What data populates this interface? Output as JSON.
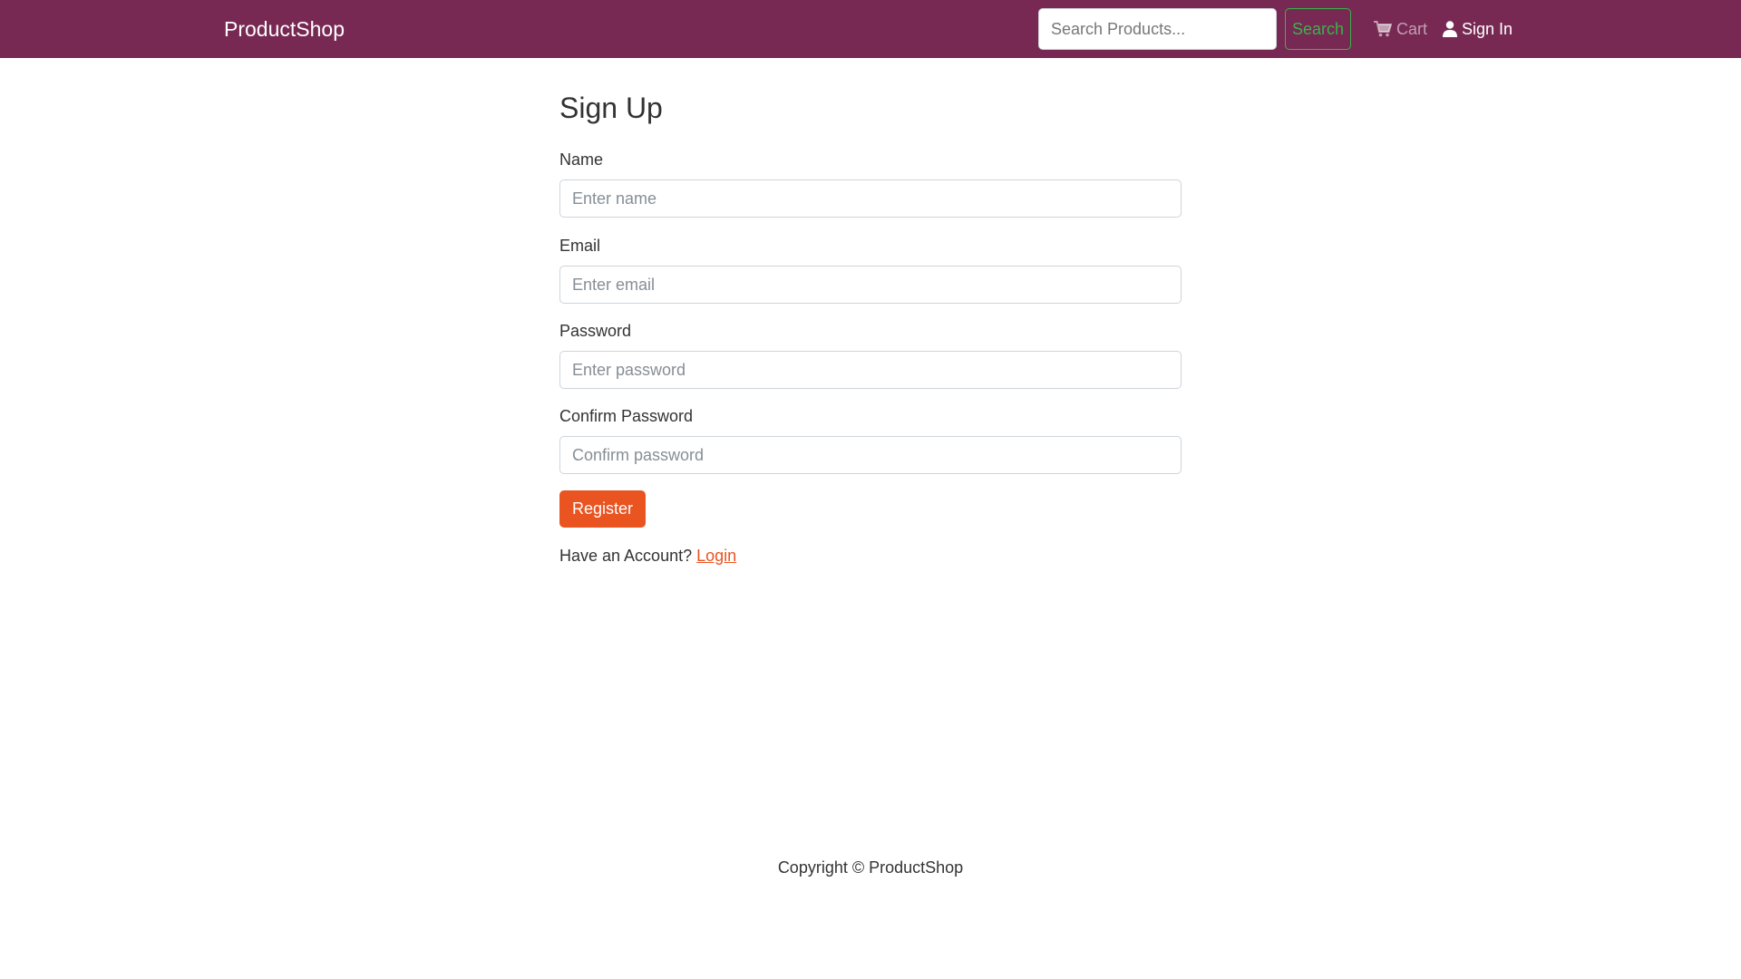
{
  "navbar": {
    "brand": "ProductShop",
    "search_placeholder": "Search Products...",
    "search_button": "Search",
    "cart_label": "Cart",
    "cart_icon": "cart-icon",
    "signin_label": "Sign In",
    "signin_icon": "user-icon",
    "background_color": "#772953"
  },
  "form": {
    "title": "Sign Up",
    "name_label": "Name",
    "name_placeholder": "Enter name",
    "email_label": "Email",
    "email_placeholder": "Enter email",
    "password_label": "Password",
    "password_placeholder": "Enter password",
    "confirm_label": "Confirm Password",
    "confirm_placeholder": "Confirm password",
    "register_button": "Register",
    "account_prompt": "Have an Account?",
    "login_link": "Login",
    "accent_color": "#e95420"
  },
  "footer": {
    "copyright": "Copyright © ProductShop"
  }
}
